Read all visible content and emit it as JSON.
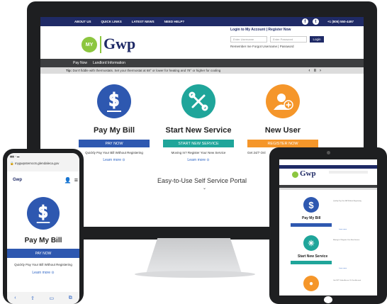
{
  "monitor": {
    "topnav": {
      "links": [
        "ABOUT US",
        "QUICK LINKS",
        "LATEST NEWS",
        "NEED HELP?"
      ],
      "phone": "+1 (805) 550-4497"
    },
    "logo": {
      "my": "MY",
      "brand": "Gwp"
    },
    "login": {
      "title": "Login to My Account  |  Register Now",
      "username_placeholder": "Enter Username",
      "password_placeholder": "Enter Password",
      "button": "Login",
      "remember": "Remember me    Forgot Username | Password"
    },
    "mainnav": [
      "Pay Now",
      "Landlord Information"
    ],
    "tip": {
      "label": "Tip:",
      "text": "Don't fiddle with thermostats. Set your thermostat at 68° or lower for heating and 78° or higher for cooling"
    },
    "cards": [
      {
        "title": "Pay My Bill",
        "button": "PAY NOW",
        "desc": "Quickly Pay Your Bill Without Registering",
        "learn": "Learn more",
        "color": "#2e58b0",
        "btn_color": "#2e58b0",
        "icon": "dollar-icon"
      },
      {
        "title": "Start New Service",
        "button": "START NEW SERVICE",
        "desc": "Moving In? Register Your New Service",
        "learn": "Learn more",
        "color": "#1fa59a",
        "btn_color": "#1fa59a",
        "icon": "tools-icon"
      },
      {
        "title": "New User",
        "button": "REGISTER NOW",
        "desc": "Get 24/7 Onl",
        "learn": "",
        "color": "#f5962a",
        "btn_color": "#f5962a",
        "icon": "add-user-icon"
      }
    ],
    "portal": "Easy-to-Use Self Service Portal"
  },
  "phone": {
    "url": "mygwpstemcc6.glendaleca.gov",
    "brand": "Gwp",
    "title": "Pay My Bill",
    "button": "PAY NOW",
    "desc": "Quickly Pay Your Bill Without Registering",
    "learn": "Learn more"
  },
  "tablet": {
    "card1_title": "Pay My Bill",
    "card1_side": "Quickly Pay Your Bill Without Registering",
    "card2_title": "Start New Service",
    "card2_side": "Moving In? Register Your New Service",
    "card3_side": "Get 24/7 Online Access To Your Account",
    "learn": "Learn more",
    "brand": "Gwp"
  },
  "colors": {
    "navy": "#1f2a66",
    "green": "#8cc63f",
    "blue": "#2e58b0",
    "teal": "#1fa59a",
    "orange": "#f5962a"
  }
}
